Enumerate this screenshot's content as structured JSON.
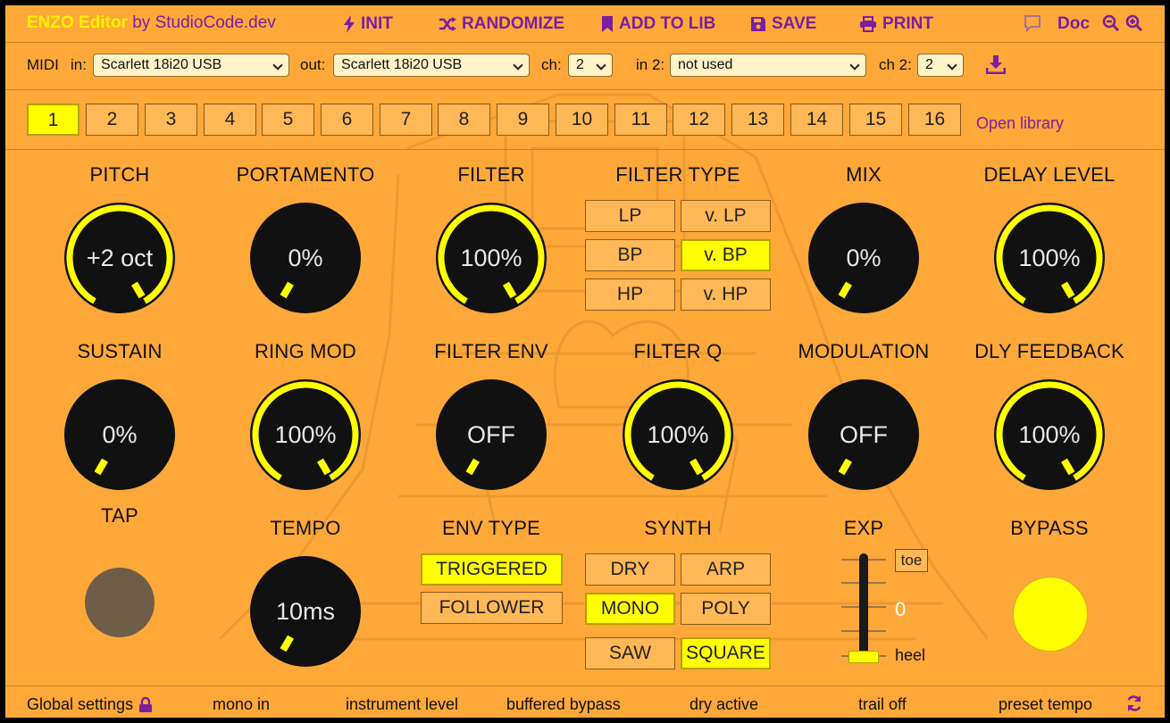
{
  "app": {
    "title": "ENZO Editor",
    "by": "by",
    "author": "StudioCode.dev"
  },
  "toolbar": {
    "init": "INIT",
    "randomize": "RANDOMIZE",
    "add_to_lib": "ADD TO LIB",
    "save": "SAVE",
    "print": "PRINT",
    "doc": "Doc"
  },
  "midi": {
    "label": "MIDI",
    "in_label": "in:",
    "in_value": "Scarlett 18i20 USB",
    "out_label": "out:",
    "out_value": "Scarlett 18i20 USB",
    "ch_label": "ch:",
    "ch_value": "2",
    "in2_label": "in 2:",
    "in2_value": "not used",
    "ch2_label": "ch 2:",
    "ch2_value": "2"
  },
  "presets": {
    "numbers": [
      "1",
      "2",
      "3",
      "4",
      "5",
      "6",
      "7",
      "8",
      "9",
      "10",
      "11",
      "12",
      "13",
      "14",
      "15",
      "16"
    ],
    "active": "1",
    "open_library": "Open library"
  },
  "knobs": {
    "pitch": {
      "title": "PITCH",
      "value": "+2 oct",
      "level": 1.0
    },
    "portamento": {
      "title": "PORTAMENTO",
      "value": "0%",
      "level": 0.0
    },
    "filter": {
      "title": "FILTER",
      "value": "100%",
      "level": 1.0
    },
    "mix": {
      "title": "MIX",
      "value": "0%",
      "level": 0.0
    },
    "delay_level": {
      "title": "DELAY LEVEL",
      "value": "100%",
      "level": 1.0
    },
    "sustain": {
      "title": "SUSTAIN",
      "value": "0%",
      "level": 0.0
    },
    "ring_mod": {
      "title": "RING MOD",
      "value": "100%",
      "level": 1.0
    },
    "filter_env": {
      "title": "FILTER ENV",
      "value": "OFF",
      "level": 0.0
    },
    "filter_q": {
      "title": "FILTER Q",
      "value": "100%",
      "level": 1.0
    },
    "modulation": {
      "title": "MODULATION",
      "value": "OFF",
      "level": 0.0
    },
    "dly_feedback": {
      "title": "DLY FEEDBACK",
      "value": "100%",
      "level": 1.0
    },
    "tempo": {
      "title": "TEMPO",
      "value": "10ms",
      "level": 0.0
    }
  },
  "filter_type": {
    "title": "FILTER TYPE",
    "options": [
      "LP",
      "v. LP",
      "BP",
      "v. BP",
      "HP",
      "v. HP"
    ],
    "selected": "v. BP"
  },
  "tap": {
    "title": "TAP"
  },
  "env_type": {
    "title": "ENV TYPE",
    "options": [
      "TRIGGERED",
      "FOLLOWER"
    ],
    "selected": "TRIGGERED"
  },
  "synth": {
    "title": "SYNTH",
    "mode_options": [
      "DRY",
      "ARP",
      "MONO",
      "POLY"
    ],
    "mode_selected": "MONO",
    "wave_options": [
      "SAW",
      "SQUARE"
    ],
    "wave_selected": "SQUARE"
  },
  "exp": {
    "title": "EXP",
    "toe": "toe",
    "value": "0",
    "heel": "heel",
    "level": 0.0
  },
  "bypass": {
    "title": "BYPASS"
  },
  "footer": {
    "global_settings": "Global settings",
    "mono_in": "mono in",
    "instrument_level": "instrument level",
    "buffered_bypass": "buffered bypass",
    "dry_active": "dry active",
    "trail_off": "trail off",
    "preset_tempo": "preset tempo"
  },
  "colors": {
    "background": "#ffa83a",
    "accent_yellow": "#ffff00",
    "link_purple": "#7b1fa2",
    "knob_body": "#111111"
  }
}
